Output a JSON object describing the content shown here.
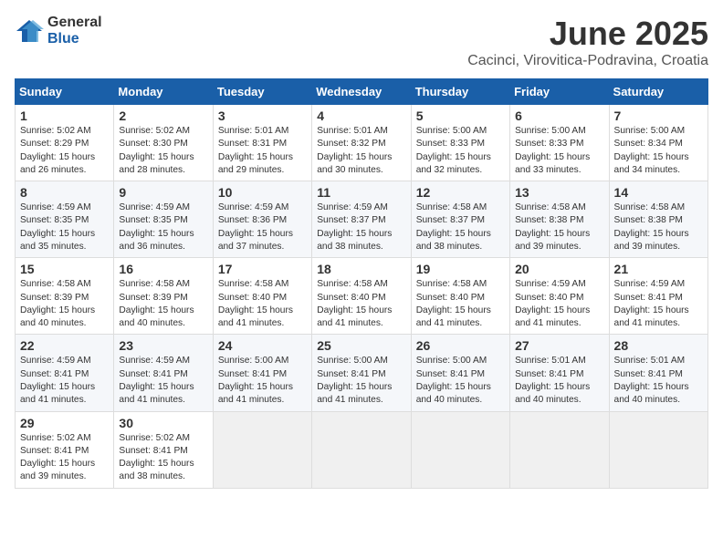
{
  "logo": {
    "general": "General",
    "blue": "Blue"
  },
  "title": "June 2025",
  "location": "Cacinci, Virovitica-Podravina, Croatia",
  "days_header": [
    "Sunday",
    "Monday",
    "Tuesday",
    "Wednesday",
    "Thursday",
    "Friday",
    "Saturday"
  ],
  "weeks": [
    [
      {
        "day": "1",
        "text": "Sunrise: 5:02 AM\nSunset: 8:29 PM\nDaylight: 15 hours\nand 26 minutes."
      },
      {
        "day": "2",
        "text": "Sunrise: 5:02 AM\nSunset: 8:30 PM\nDaylight: 15 hours\nand 28 minutes."
      },
      {
        "day": "3",
        "text": "Sunrise: 5:01 AM\nSunset: 8:31 PM\nDaylight: 15 hours\nand 29 minutes."
      },
      {
        "day": "4",
        "text": "Sunrise: 5:01 AM\nSunset: 8:32 PM\nDaylight: 15 hours\nand 30 minutes."
      },
      {
        "day": "5",
        "text": "Sunrise: 5:00 AM\nSunset: 8:33 PM\nDaylight: 15 hours\nand 32 minutes."
      },
      {
        "day": "6",
        "text": "Sunrise: 5:00 AM\nSunset: 8:33 PM\nDaylight: 15 hours\nand 33 minutes."
      },
      {
        "day": "7",
        "text": "Sunrise: 5:00 AM\nSunset: 8:34 PM\nDaylight: 15 hours\nand 34 minutes."
      }
    ],
    [
      {
        "day": "8",
        "text": "Sunrise: 4:59 AM\nSunset: 8:35 PM\nDaylight: 15 hours\nand 35 minutes."
      },
      {
        "day": "9",
        "text": "Sunrise: 4:59 AM\nSunset: 8:35 PM\nDaylight: 15 hours\nand 36 minutes."
      },
      {
        "day": "10",
        "text": "Sunrise: 4:59 AM\nSunset: 8:36 PM\nDaylight: 15 hours\nand 37 minutes."
      },
      {
        "day": "11",
        "text": "Sunrise: 4:59 AM\nSunset: 8:37 PM\nDaylight: 15 hours\nand 38 minutes."
      },
      {
        "day": "12",
        "text": "Sunrise: 4:58 AM\nSunset: 8:37 PM\nDaylight: 15 hours\nand 38 minutes."
      },
      {
        "day": "13",
        "text": "Sunrise: 4:58 AM\nSunset: 8:38 PM\nDaylight: 15 hours\nand 39 minutes."
      },
      {
        "day": "14",
        "text": "Sunrise: 4:58 AM\nSunset: 8:38 PM\nDaylight: 15 hours\nand 39 minutes."
      }
    ],
    [
      {
        "day": "15",
        "text": "Sunrise: 4:58 AM\nSunset: 8:39 PM\nDaylight: 15 hours\nand 40 minutes."
      },
      {
        "day": "16",
        "text": "Sunrise: 4:58 AM\nSunset: 8:39 PM\nDaylight: 15 hours\nand 40 minutes."
      },
      {
        "day": "17",
        "text": "Sunrise: 4:58 AM\nSunset: 8:40 PM\nDaylight: 15 hours\nand 41 minutes."
      },
      {
        "day": "18",
        "text": "Sunrise: 4:58 AM\nSunset: 8:40 PM\nDaylight: 15 hours\nand 41 minutes."
      },
      {
        "day": "19",
        "text": "Sunrise: 4:58 AM\nSunset: 8:40 PM\nDaylight: 15 hours\nand 41 minutes."
      },
      {
        "day": "20",
        "text": "Sunrise: 4:59 AM\nSunset: 8:40 PM\nDaylight: 15 hours\nand 41 minutes."
      },
      {
        "day": "21",
        "text": "Sunrise: 4:59 AM\nSunset: 8:41 PM\nDaylight: 15 hours\nand 41 minutes."
      }
    ],
    [
      {
        "day": "22",
        "text": "Sunrise: 4:59 AM\nSunset: 8:41 PM\nDaylight: 15 hours\nand 41 minutes."
      },
      {
        "day": "23",
        "text": "Sunrise: 4:59 AM\nSunset: 8:41 PM\nDaylight: 15 hours\nand 41 minutes."
      },
      {
        "day": "24",
        "text": "Sunrise: 5:00 AM\nSunset: 8:41 PM\nDaylight: 15 hours\nand 41 minutes."
      },
      {
        "day": "25",
        "text": "Sunrise: 5:00 AM\nSunset: 8:41 PM\nDaylight: 15 hours\nand 41 minutes."
      },
      {
        "day": "26",
        "text": "Sunrise: 5:00 AM\nSunset: 8:41 PM\nDaylight: 15 hours\nand 40 minutes."
      },
      {
        "day": "27",
        "text": "Sunrise: 5:01 AM\nSunset: 8:41 PM\nDaylight: 15 hours\nand 40 minutes."
      },
      {
        "day": "28",
        "text": "Sunrise: 5:01 AM\nSunset: 8:41 PM\nDaylight: 15 hours\nand 40 minutes."
      }
    ],
    [
      {
        "day": "29",
        "text": "Sunrise: 5:02 AM\nSunset: 8:41 PM\nDaylight: 15 hours\nand 39 minutes."
      },
      {
        "day": "30",
        "text": "Sunrise: 5:02 AM\nSunset: 8:41 PM\nDaylight: 15 hours\nand 38 minutes."
      },
      {
        "day": "",
        "text": ""
      },
      {
        "day": "",
        "text": ""
      },
      {
        "day": "",
        "text": ""
      },
      {
        "day": "",
        "text": ""
      },
      {
        "day": "",
        "text": ""
      }
    ]
  ]
}
